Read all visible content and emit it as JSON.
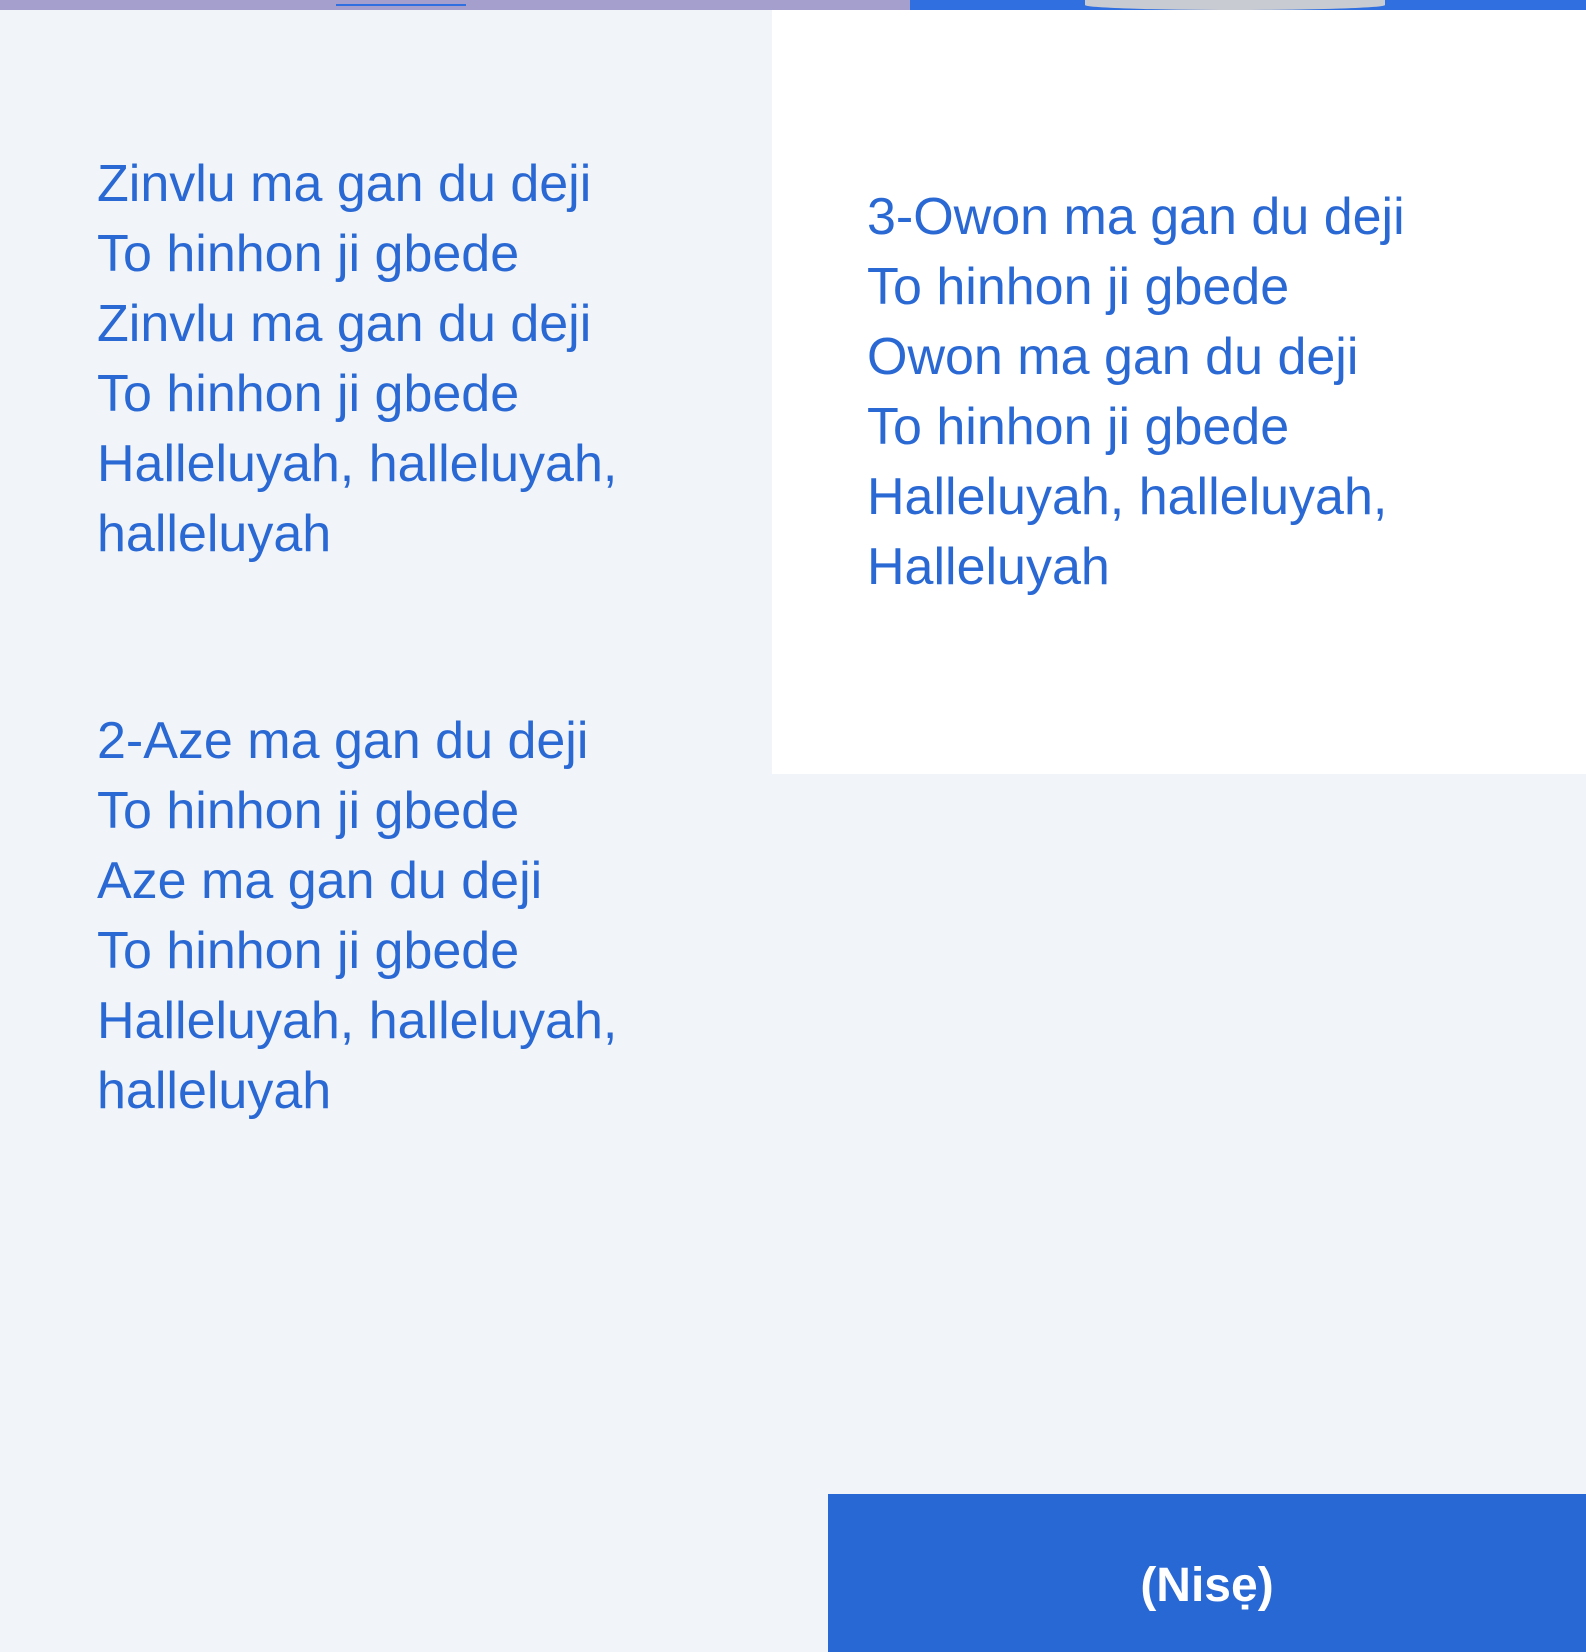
{
  "verses": [
    {
      "lines": [
        "Zinvlu ma gan du deji",
        "To hinhon ji gbede",
        "Zinvlu ma gan du deji",
        "To hinhon ji gbede",
        "Halleluyah, halleluyah,",
        "halleluyah"
      ]
    },
    {
      "lines": [
        "2-Aze ma gan du deji",
        "To hinhon ji gbede",
        "Aze ma gan du deji",
        "To hinhon ji gbede",
        "Halleluyah, halleluyah,",
        "halleluyah"
      ]
    },
    {
      "lines": [
        "3-Owon ma gan du deji",
        "To hinhon ji gbede",
        "Owon ma gan du deji",
        "To hinhon ji gbede",
        "Halleluyah, halleluyah,",
        "Halleluyah"
      ]
    }
  ],
  "footer": {
    "nise_label": "(Nisẹ)"
  },
  "colors": {
    "lyrics_text": "#2a68d4",
    "button_bg": "#2868d4",
    "page_bg": "#f1f5f9",
    "panel_bg": "#ffffff"
  }
}
